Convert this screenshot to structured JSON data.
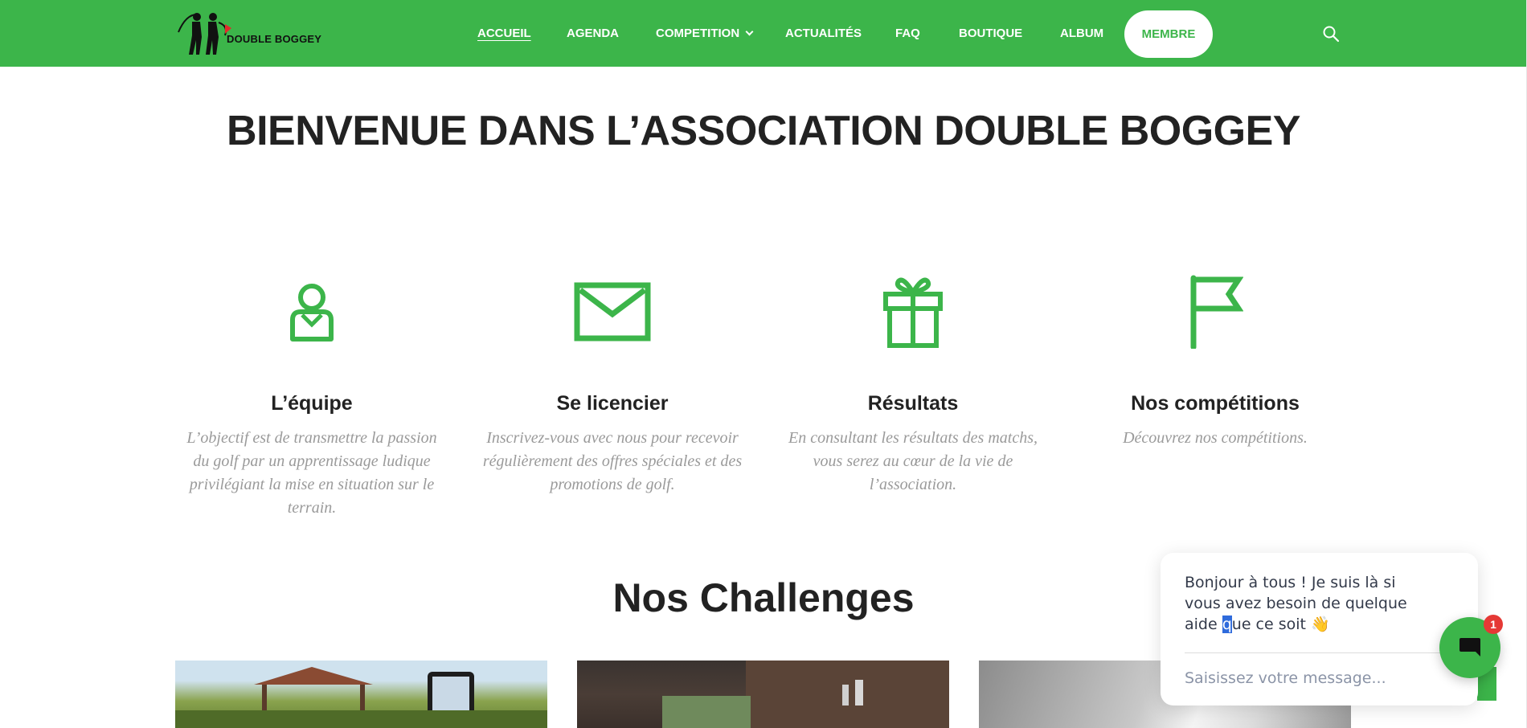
{
  "brand": {
    "name": "DOUBLE BOGGEY",
    "accent": "#3cb54a"
  },
  "nav": {
    "items": [
      {
        "label": "ACCUEIL",
        "active": true
      },
      {
        "label": "AGENDA"
      },
      {
        "label": "COMPETITION",
        "has_dropdown": true
      },
      {
        "label": "ACTUALITÉS"
      },
      {
        "label": "FAQ"
      },
      {
        "label": "BOUTIQUE"
      },
      {
        "label": "ALBUM"
      }
    ],
    "member_button": "MEMBRE",
    "search_icon": "search-icon"
  },
  "hero": {
    "title": "BIENVENUE DANS L’ASSOCIATION DOUBLE BOGGEY"
  },
  "features": [
    {
      "icon": "person-icon",
      "title": "L’équipe",
      "text": "L’objectif est de transmettre la passion du golf par un apprentissage ludique privilégiant la mise en situation sur le terrain."
    },
    {
      "icon": "envelope-icon",
      "title": "Se licencier",
      "text": "Inscrivez-vous avec nous pour recevoir régulièrement des offres spéciales et des promotions de golf."
    },
    {
      "icon": "gift-icon",
      "title": "Résultats",
      "text": "En consultant les résultats des matchs, vous serez au cœur de la vie de l’association."
    },
    {
      "icon": "flag-icon",
      "title": "Nos compétitions",
      "text": "Découvrez nos compétitions."
    }
  ],
  "challenges": {
    "title": "Nos Challenges"
  },
  "chat": {
    "message_before": "Bonjour à tous ! Je suis là si vous avez besoin de quelque aide ",
    "message_selected": "q",
    "message_after": "ue ce soit",
    "emoji": "👋",
    "input_placeholder": "Saisissez votre message...",
    "badge_count": "1"
  }
}
